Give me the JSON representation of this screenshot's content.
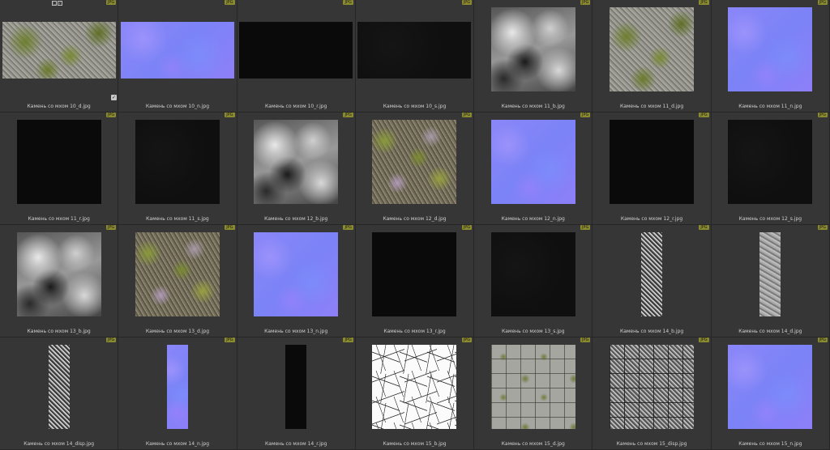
{
  "toolbar": {
    "icons": [
      "select-icon",
      "pencil-icon"
    ],
    "select_glyph": "□",
    "pencil_glyph": "/",
    "check_glyph": "✓"
  },
  "badge_text": "JPG",
  "colors": {
    "badge": "#8a8a2e",
    "cell": "#363636",
    "background": "#2b2b2b",
    "normal_map": "#7f7ff8"
  },
  "files": [
    {
      "label": "Камень со мхом 10_d.jpg",
      "texture": "moss",
      "shape": "wide"
    },
    {
      "label": "Камень со мхом 10_n.jpg",
      "texture": "normal",
      "shape": "wide"
    },
    {
      "label": "Камень со мхом 10_r.jpg",
      "texture": "black",
      "shape": "wide"
    },
    {
      "label": "Камень со мхом 10_s.jpg",
      "texture": "dark",
      "shape": "wide"
    },
    {
      "label": "Камень со мхом 11_b.jpg",
      "texture": "bump",
      "shape": "square"
    },
    {
      "label": "Камень со мхом 11_d.jpg",
      "texture": "moss",
      "shape": "square"
    },
    {
      "label": "Камень со мхом 11_n.jpg",
      "texture": "normal",
      "shape": "square"
    },
    {
      "label": "Камень со мхом 11_r.jpg",
      "texture": "black",
      "shape": "square"
    },
    {
      "label": "Камень со мхом 11_s.jpg",
      "texture": "dark",
      "shape": "square"
    },
    {
      "label": "Камень со мхом 12_b.jpg",
      "texture": "bump",
      "shape": "square"
    },
    {
      "label": "Камень со мхом 12_d.jpg",
      "texture": "mossdense",
      "shape": "square"
    },
    {
      "label": "Камень со мхом 12_n.jpg",
      "texture": "normal",
      "shape": "square"
    },
    {
      "label": "Камень со мхом 12_r.jpg",
      "texture": "black",
      "shape": "square"
    },
    {
      "label": "Камень со мхом 12_s.jpg",
      "texture": "dark",
      "shape": "square"
    },
    {
      "label": "Камень со мхом 13_b.jpg",
      "texture": "bump",
      "shape": "square"
    },
    {
      "label": "Камень со мхом 13_d.jpg",
      "texture": "mossdense",
      "shape": "square"
    },
    {
      "label": "Камень со мхом 13_n.jpg",
      "texture": "normal",
      "shape": "square"
    },
    {
      "label": "Камень со мхом 13_r.jpg",
      "texture": "black",
      "shape": "square"
    },
    {
      "label": "Камень со мхом 13_s.jpg",
      "texture": "dark",
      "shape": "square"
    },
    {
      "label": "Камень со мхом 14_b.jpg",
      "texture": "disp",
      "shape": "tall"
    },
    {
      "label": "Камень со мхом 14_d.jpg",
      "texture": "stone",
      "shape": "tall"
    },
    {
      "label": "Камень со мхом 14_disp.jpg",
      "texture": "disp",
      "shape": "tall"
    },
    {
      "label": "Камень со мхом 14_n.jpg",
      "texture": "normal",
      "shape": "tall"
    },
    {
      "label": "Камень со мхом 14_r.jpg",
      "texture": "black",
      "shape": "tall"
    },
    {
      "label": "Камень со мхом 15_b.jpg",
      "texture": "white",
      "shape": "square"
    },
    {
      "label": "Камень со мхом 15_d.jpg",
      "texture": "tiles",
      "shape": "square"
    },
    {
      "label": "Камень со мхом 15_disp.jpg",
      "texture": "tilesbump",
      "shape": "square"
    },
    {
      "label": "Камень со мхом 15_n.jpg",
      "texture": "normal",
      "shape": "square"
    }
  ]
}
